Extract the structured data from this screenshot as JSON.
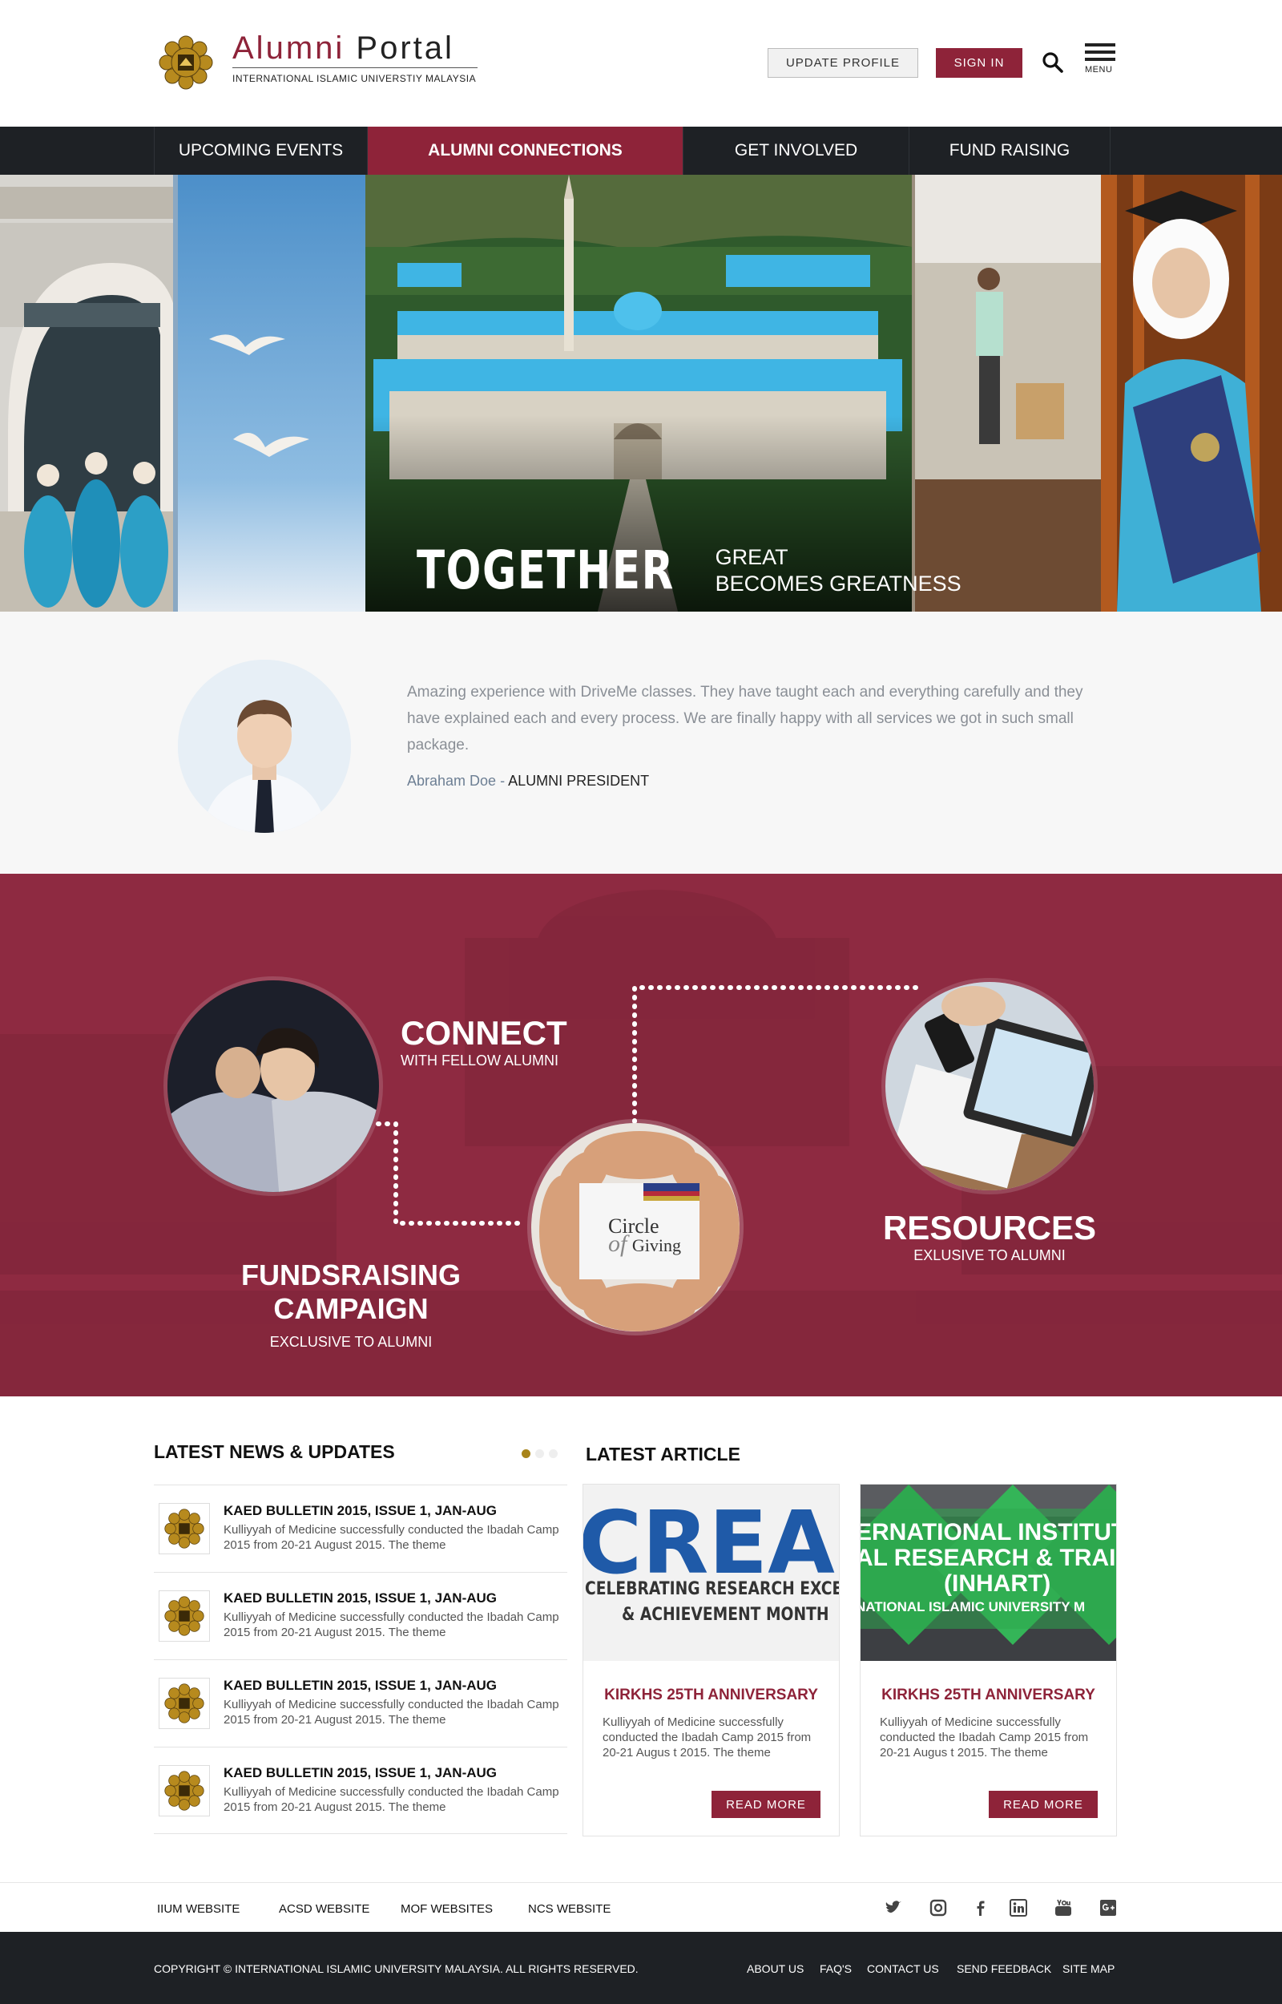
{
  "header": {
    "logo_word1": "Alumni",
    "logo_word2": "Portal",
    "logo_sub": "INTERNATIONAL ISLAMIC UNIVERSTIY MALAYSIA",
    "update_profile": "UPDATE PROFILE",
    "sign_in": "SIGN IN",
    "menu_label": "MENU",
    "search_icon": "search-icon",
    "menu_icon": "hamburger-icon"
  },
  "nav": {
    "items": [
      {
        "label": "UPCOMING EVENTS"
      },
      {
        "label": "ALUMNI CONNECTIONS"
      },
      {
        "label": "GET INVOLVED"
      },
      {
        "label": "FUND RAISING"
      }
    ],
    "active": "ALUMNI CONNECTIONS"
  },
  "hero": {
    "big": "TOGETHER",
    "small_1": "GREAT",
    "small_2": "BECOMES GREATNESS"
  },
  "testimonial": {
    "quote": "Amazing experience with DriveMe classes. They have taught each and everything carefully and they have explained each and every process. We are finally happy with all services we got in such small package.",
    "name": "Abraham Doe",
    "separator": " - ",
    "role": "ALUMNI PRESIDENT"
  },
  "connect_section": {
    "connect_title": "CONNECT",
    "connect_sub": "WITH FELLOW ALUMNI",
    "fund_title": "FUNDSRAISING CAMPAIGN",
    "fund_sub": "EXCLUSIVE TO ALUMNI",
    "resources_title": "RESOURCES",
    "resources_sub": "EXLUSIVE TO ALUMNI",
    "circle_line1": "Circle",
    "circle_line2": "Giving",
    "circle_of": "of"
  },
  "news": {
    "title": "LATEST NEWS & UPDATES",
    "items": [
      {
        "title": "KAED BULLETIN 2015, ISSUE 1, JAN-AUG",
        "desc": "Kulliyyah of Medicine successfully conducted the Ibadah Camp 2015 from 20-21 August 2015.  The theme"
      },
      {
        "title": "KAED BULLETIN 2015, ISSUE 1, JAN-AUG",
        "desc": "Kulliyyah of Medicine successfully conducted the Ibadah Camp 2015 from 20-21 August 2015.  The theme"
      },
      {
        "title": "KAED BULLETIN 2015, ISSUE 1, JAN-AUG",
        "desc": "Kulliyyah of Medicine successfully conducted the Ibadah Camp 2015 from 20-21 August 2015.  The theme"
      },
      {
        "title": "KAED BULLETIN 2015, ISSUE 1, JAN-AUG",
        "desc": "Kulliyyah of Medicine successfully conducted the Ibadah Camp 2015 from 20-21 August 2015.  The theme"
      }
    ]
  },
  "articles": {
    "title": "LATEST ARTICLE",
    "cards": [
      {
        "img_big": "CREAM",
        "img_line1": "CELEBRATING RESEARCH EXCELLE",
        "img_line2": "& ACHIEVEMENT MONTH",
        "title": "KIRKHS 25TH ANNIVERSARY",
        "desc": "Kulliyyah of Medicine successfully conducted the Ibadah Camp 2015 from 20-21 Augus t 2015.  The theme",
        "button": "READ MORE"
      },
      {
        "img_line1": "ERNATIONAL INSTITUT",
        "img_line2": "AL RESEARCH & TRAI",
        "img_line3": "(INHART)",
        "img_line4": "NATIONAL ISLAMIC UNIVERSITY M",
        "title": "KIRKHS 25TH ANNIVERSARY",
        "desc": "Kulliyyah of Medicine successfully conducted the Ibadah Camp 2015 from 20-21 Augus t 2015.  The theme",
        "button": "READ MORE"
      }
    ]
  },
  "footer_links": {
    "items": [
      "IIUM WEBSITE",
      "ACSD WEBSITE",
      "MOF WEBSITES",
      "NCS WEBSITE"
    ],
    "social": [
      "twitter-icon",
      "instagram-icon",
      "facebook-icon",
      "linkedin-icon",
      "youtube-icon",
      "google-plus-icon"
    ]
  },
  "footer": {
    "copyright": "COPYRIGHT © INTERNATIONAL ISLAMIC UNIVERSITY MALAYSIA. ALL RIGHTS RESERVED.",
    "links": [
      "ABOUT US",
      "FAQ'S",
      "CONTACT US",
      "SEND FEEDBACK",
      "SITE MAP"
    ]
  },
  "colors": {
    "brand": "#8e2339",
    "dark": "#1e2125",
    "crimson_bg": "#8e2a41",
    "gold": "#a8841a"
  }
}
